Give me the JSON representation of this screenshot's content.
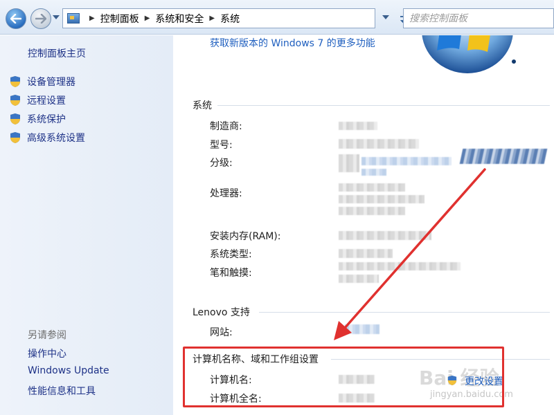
{
  "navbar": {
    "breadcrumb": [
      "控制面板",
      "系统和安全",
      "系统"
    ],
    "search_placeholder": "搜索控制面板"
  },
  "sidebar": {
    "home": "控制面板主页",
    "tasks": [
      "设备管理器",
      "远程设置",
      "系统保护",
      "高级系统设置"
    ],
    "see_also_title": "另请参阅",
    "see_also": [
      "操作中心",
      "Windows Update",
      "性能信息和工具"
    ]
  },
  "main": {
    "promo_link": "获取新版本的 Windows 7 的更多功能",
    "system": {
      "title": "系统",
      "labels": [
        "制造商:",
        "型号:",
        "分级:",
        "处理器:",
        "安装内存(RAM):",
        "系统类型:",
        "笔和触摸:"
      ]
    },
    "support": {
      "title": "Lenovo 支持",
      "website_label": "网站:"
    },
    "computer": {
      "title": "计算机名称、域和工作组设置",
      "name_label": "计算机名:",
      "fullname_label": "计算机全名:",
      "change_settings": "更改设置"
    },
    "watermark": {
      "line1": "Bai 经验",
      "line2": "jingyan.baidu.com"
    }
  },
  "colors": {
    "link": "#1f5fbf",
    "annotation": "#e0312f",
    "sidebar_bg": "#e4ecf7"
  }
}
